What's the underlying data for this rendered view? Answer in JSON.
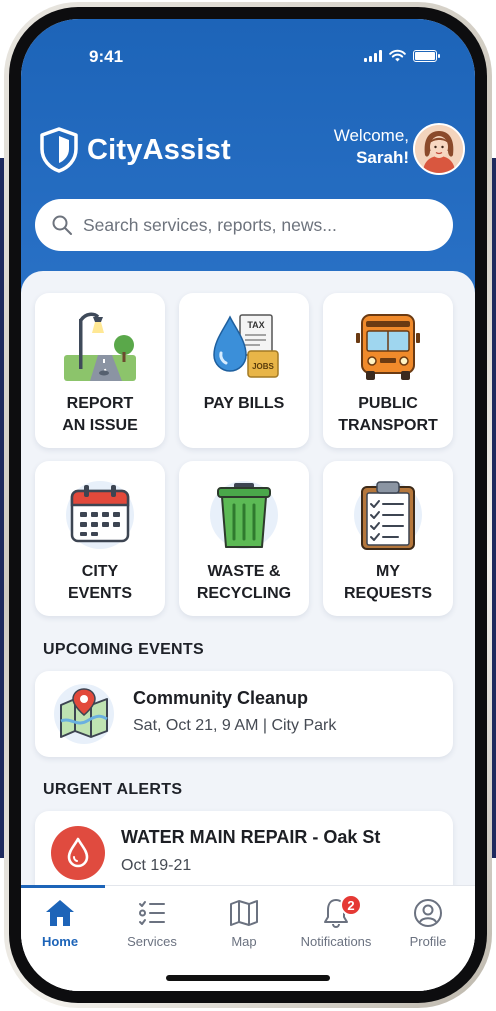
{
  "status_bar": {
    "time": "9:41"
  },
  "header": {
    "app_name": "CityAssist",
    "welcome_line1": "Welcome,",
    "welcome_line2": "Sarah!"
  },
  "search": {
    "placeholder": "Search services, reports, news..."
  },
  "quick_actions": [
    {
      "label": "REPORT\nAN ISSUE",
      "icon": "streetlight-park-icon"
    },
    {
      "label": "PAY BILLS",
      "icon": "water-drop-tax-bill-icon"
    },
    {
      "label": "PUBLIC\nTRANSPORT",
      "icon": "bus-icon"
    },
    {
      "label": "CITY\nEVENTS",
      "icon": "calendar-icon"
    },
    {
      "label": "WASTE &\nRECYCLING",
      "icon": "trash-bin-icon"
    },
    {
      "label": "MY\nREQUESTS",
      "icon": "clipboard-checklist-icon"
    }
  ],
  "bill_icon_text": {
    "tax": "TAX",
    "jobs": "JOBS"
  },
  "upcoming_events": {
    "title": "UPCOMING EVENTS",
    "items": [
      {
        "title": "Community Cleanup",
        "subtitle": "Sat, Oct 21, 9 AM | City Park",
        "icon": "map-pin-icon"
      }
    ]
  },
  "urgent_alerts": {
    "title": "URGENT ALERTS",
    "items": [
      {
        "title": "WATER MAIN REPAIR - Oak St",
        "subtitle": "Oct 19-21",
        "icon": "water-drop-alert-icon"
      }
    ]
  },
  "tab_bar": {
    "active": "Home",
    "tabs": [
      {
        "label": "Home",
        "icon": "home-icon"
      },
      {
        "label": "Services",
        "icon": "services-list-icon"
      },
      {
        "label": "Map",
        "icon": "map-icon"
      },
      {
        "label": "Notifications",
        "icon": "bell-icon",
        "badge": "2"
      },
      {
        "label": "Profile",
        "icon": "profile-icon"
      }
    ]
  },
  "colors": {
    "brand_blue": "#1d64b8",
    "alert_red": "#e04b3f",
    "badge_red": "#e53935",
    "background": "#f1f4f9"
  }
}
